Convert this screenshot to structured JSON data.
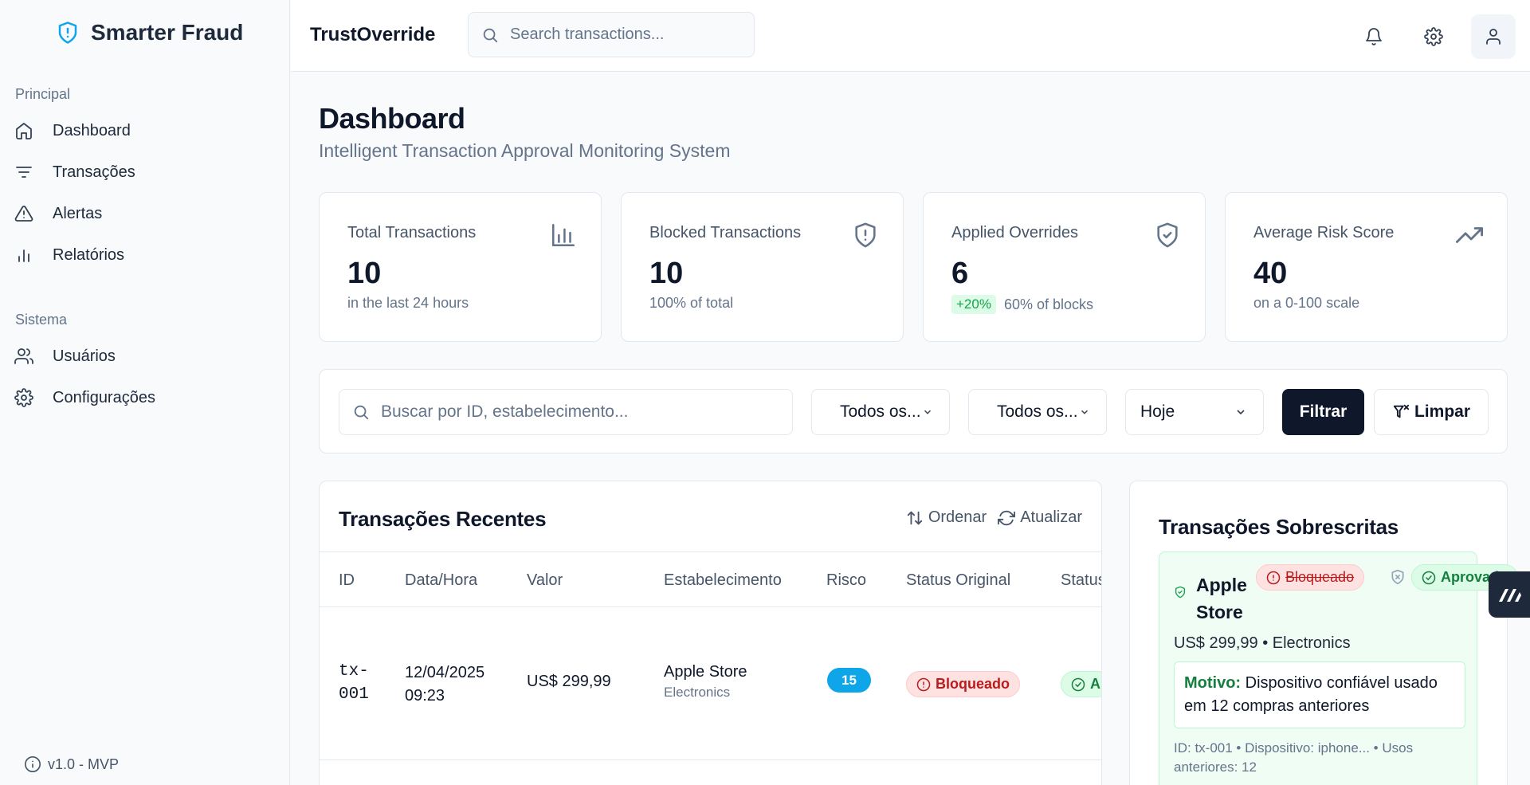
{
  "sidebar": {
    "brand": "Smarter Fraud",
    "sections": [
      {
        "title": "Principal",
        "items": [
          "Dashboard",
          "Transações",
          "Alertas",
          "Relatórios"
        ]
      },
      {
        "title": "Sistema",
        "items": [
          "Usuários",
          "Configurações"
        ]
      }
    ],
    "version": "v1.0 - MVP"
  },
  "header": {
    "app_title": "TrustOverride",
    "search_placeholder": "Search transactions..."
  },
  "page": {
    "title": "Dashboard",
    "subtitle": "Intelligent Transaction Approval Monitoring System"
  },
  "stats": [
    {
      "label": "Total Transactions",
      "value": "10",
      "sub": "in the last 24 hours",
      "icon": "bar-chart-icon"
    },
    {
      "label": "Blocked Transactions",
      "value": "10",
      "sub": "100% of total",
      "icon": "shield-alert-icon"
    },
    {
      "label": "Applied Overrides",
      "value": "6",
      "badge": "+20%",
      "sub": "60% of blocks",
      "icon": "shield-check-icon"
    },
    {
      "label": "Average Risk Score",
      "value": "40",
      "sub": "on a 0-100 scale",
      "icon": "trending-up-icon"
    }
  ],
  "filters": {
    "search_placeholder": "Buscar por ID, estabelecimento...",
    "select_1": "Todos os...",
    "select_2": "Todos os...",
    "select_3": "Hoje",
    "filter_button": "Filtrar",
    "clear_button": "Limpar"
  },
  "recent": {
    "title": "Transações Recentes",
    "sort_label": "Ordenar",
    "refresh_label": "Atualizar",
    "columns": [
      "ID",
      "Data/Hora",
      "Valor",
      "Estabelecimento",
      "Risco",
      "Status Original",
      "Status"
    ],
    "rows": [
      {
        "id_line1": "tx-",
        "id_line2": "001",
        "date": "12/04/2025",
        "time": "09:23",
        "value": "US$ 299,99",
        "merchant": "Apple Store",
        "category": "Electronics",
        "risk": "15",
        "original_status": "Bloqueado",
        "status": "A"
      }
    ]
  },
  "overrides": {
    "title": "Transações Sobrescritas",
    "item": {
      "name": "Apple Store",
      "from_status": "Bloqueado",
      "to_status": "Aprovado",
      "price_line": "US$ 299,99 • Electronics",
      "reason_label": "Motivo:",
      "reason": "Dispositivo confiável usado em 12 compras anteriores",
      "meta": "ID: tx-001 • Dispositivo: iphone... • Usos anteriores: 12"
    }
  },
  "colors": {
    "accent_blue": "#0ea5e9",
    "dark": "#0f172a",
    "green": "#16a34a",
    "red": "#b91c1c"
  }
}
